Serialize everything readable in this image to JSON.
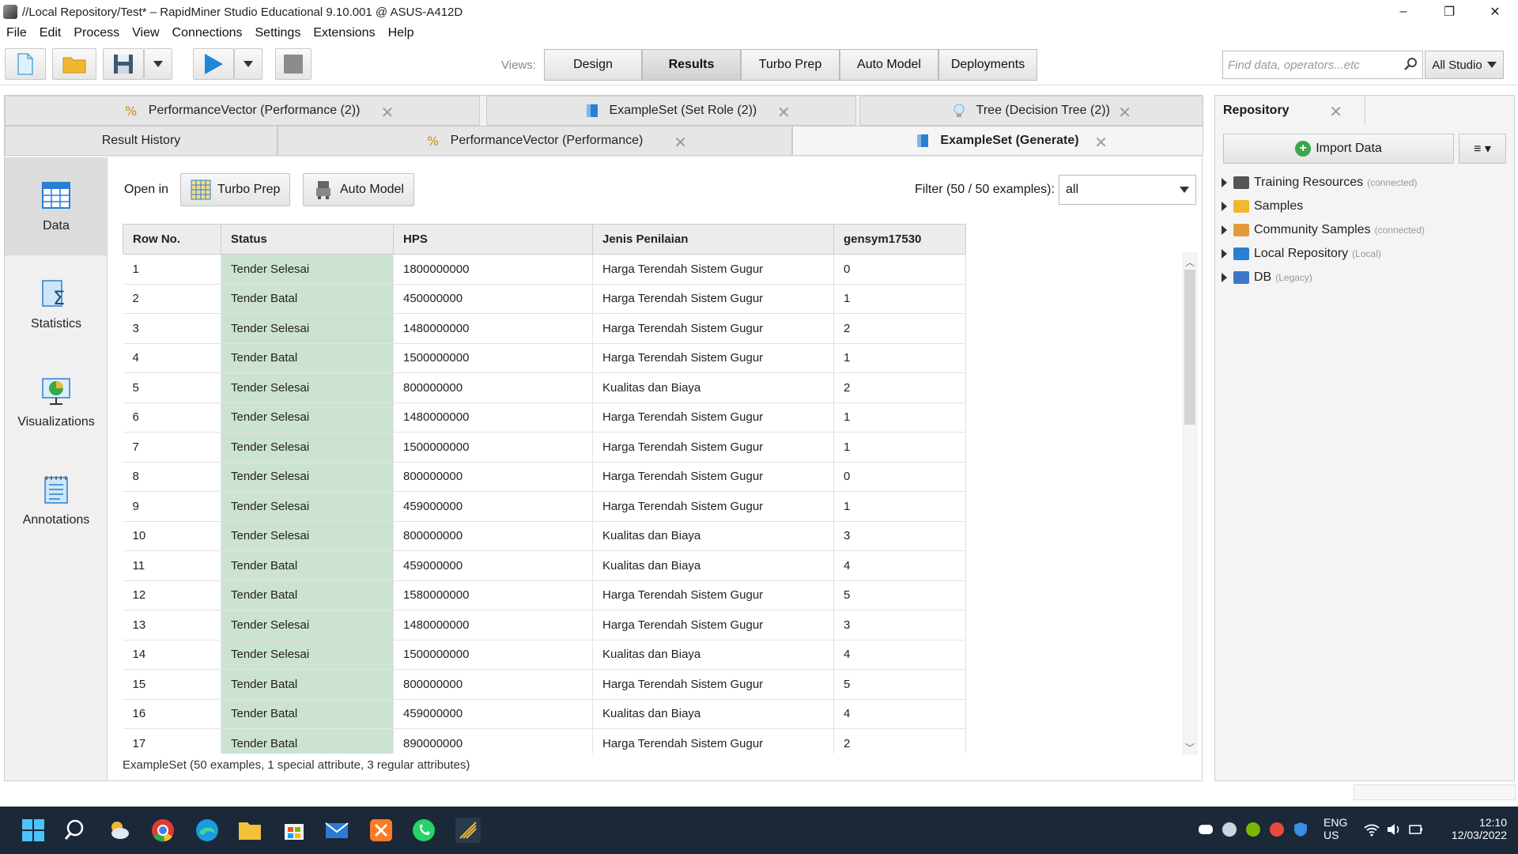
{
  "window": {
    "title": "//Local Repository/Test* – RapidMiner Studio Educational 9.10.001 @ ASUS-A412D",
    "minimize": "–",
    "restore": "❐",
    "close": "✕"
  },
  "menu": [
    "File",
    "Edit",
    "Process",
    "View",
    "Connections",
    "Settings",
    "Extensions",
    "Help"
  ],
  "views": {
    "label": "Views:",
    "items": [
      "Design",
      "Results",
      "Turbo Prep",
      "Auto Model",
      "Deployments"
    ],
    "active": "Results"
  },
  "search": {
    "placeholder": "Find data, operators...etc",
    "scope": "All Studio"
  },
  "result_tabs_top": [
    {
      "label": "PerformanceVector (Performance (2))"
    },
    {
      "label": "ExampleSet (Set Role (2))"
    },
    {
      "label": "Tree (Decision Tree (2))"
    }
  ],
  "result_tabs_bottom": [
    {
      "label": "Result History"
    },
    {
      "label": "PerformanceVector (Performance)"
    },
    {
      "label": "ExampleSet (Generate)",
      "active": true
    }
  ],
  "side_views": [
    "Data",
    "Statistics",
    "Visualizations",
    "Annotations"
  ],
  "open_in": {
    "label": "Open in",
    "turbo_prep": "Turbo Prep",
    "auto_model": "Auto Model"
  },
  "filter": {
    "label": "Filter (50 / 50 examples):",
    "value": "all"
  },
  "table": {
    "columns": [
      "Row No.",
      "Status",
      "HPS",
      "Jenis Penilaian",
      "gensym17530"
    ],
    "rows": [
      [
        "1",
        "Tender Selesai",
        "1800000000",
        "Harga Terendah Sistem Gugur",
        "0"
      ],
      [
        "2",
        "Tender Batal",
        "450000000",
        "Harga Terendah Sistem Gugur",
        "1"
      ],
      [
        "3",
        "Tender Selesai",
        "1480000000",
        "Harga Terendah Sistem Gugur",
        "2"
      ],
      [
        "4",
        "Tender Batal",
        "1500000000",
        "Harga Terendah Sistem Gugur",
        "1"
      ],
      [
        "5",
        "Tender Selesai",
        "800000000",
        "Kualitas dan Biaya",
        "2"
      ],
      [
        "6",
        "Tender Selesai",
        "1480000000",
        "Harga Terendah Sistem Gugur",
        "1"
      ],
      [
        "7",
        "Tender Selesai",
        "1500000000",
        "Harga Terendah Sistem Gugur",
        "1"
      ],
      [
        "8",
        "Tender Selesai",
        "800000000",
        "Harga Terendah Sistem Gugur",
        "0"
      ],
      [
        "9",
        "Tender Selesai",
        "459000000",
        "Harga Terendah Sistem Gugur",
        "1"
      ],
      [
        "10",
        "Tender Selesai",
        "800000000",
        "Kualitas dan Biaya",
        "3"
      ],
      [
        "11",
        "Tender Batal",
        "459000000",
        "Kualitas dan Biaya",
        "4"
      ],
      [
        "12",
        "Tender Batal",
        "1580000000",
        "Harga Terendah Sistem Gugur",
        "5"
      ],
      [
        "13",
        "Tender Selesai",
        "1480000000",
        "Harga Terendah Sistem Gugur",
        "3"
      ],
      [
        "14",
        "Tender Selesai",
        "1500000000",
        "Kualitas dan Biaya",
        "4"
      ],
      [
        "15",
        "Tender Batal",
        "800000000",
        "Harga Terendah Sistem Gugur",
        "5"
      ],
      [
        "16",
        "Tender Batal",
        "459000000",
        "Kualitas dan Biaya",
        "4"
      ],
      [
        "17",
        "Tender Batal",
        "890000000",
        "Harga Terendah Sistem Gugur",
        "2"
      ]
    ]
  },
  "status_line": "ExampleSet (50 examples, 1 special attribute, 3 regular attributes)",
  "repository": {
    "tab": "Repository",
    "import": "Import Data",
    "menu": "≡ ▾",
    "items": [
      {
        "label": "Training Resources",
        "sub": "(connected)",
        "icon_color": "#555555"
      },
      {
        "label": "Samples",
        "sub": "",
        "icon_color": "#f2b731"
      },
      {
        "label": "Community Samples",
        "sub": "(connected)",
        "icon_color": "#e39a3b"
      },
      {
        "label": "Local Repository",
        "sub": "(Local)",
        "icon_color": "#2a7fd4"
      },
      {
        "label": "DB",
        "sub": "(Legacy)",
        "icon_color": "#3a78c8"
      }
    ]
  },
  "taskbar": {
    "lang": "ENG",
    "region": "US",
    "time": "12:10",
    "date": "12/03/2022"
  }
}
